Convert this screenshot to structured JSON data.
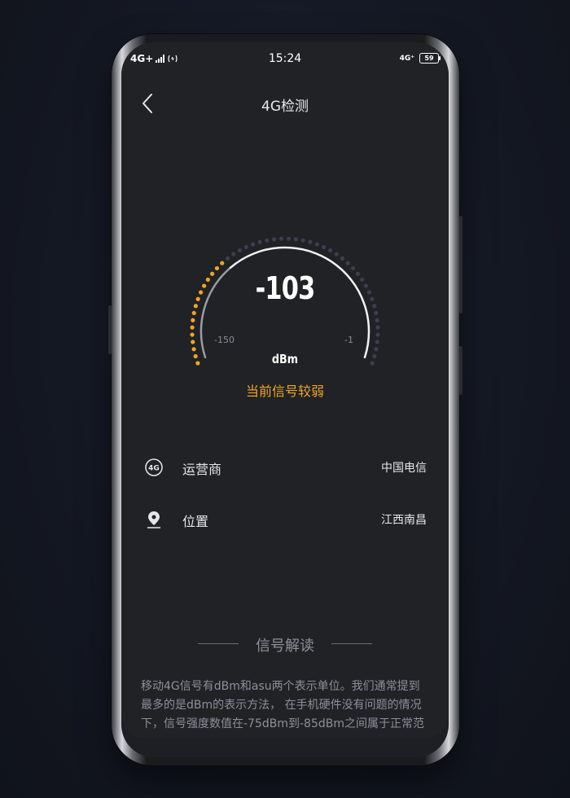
{
  "status_bar": {
    "network": "4G+",
    "time": "15:24",
    "network_right": "4G⁺",
    "battery": "59"
  },
  "header": {
    "title": "4G检测",
    "back_icon": "chevron-left-icon"
  },
  "gauge": {
    "value": "-103",
    "unit": "dBm",
    "min_label": "-150",
    "max_label": "-1",
    "status": "当前信号较弱",
    "min": -150,
    "max": -1,
    "current": -103,
    "active_color": "#f0a428",
    "inactive_color": "#3c3f4e"
  },
  "info": [
    {
      "icon": "4g-icon",
      "label": "运营商",
      "value": "中国电信"
    },
    {
      "icon": "location-pin-icon",
      "label": "位置",
      "value": "江西南昌"
    }
  ],
  "section": {
    "title": "信号解读",
    "description": "移动4G信号有dBm和asu两个表示单位。我们通常提到最多的是dBm的表示方法， 在手机硬件没有问题的情况下，信号强度数值在-75dBm到-85dBm之间属于正常范"
  }
}
